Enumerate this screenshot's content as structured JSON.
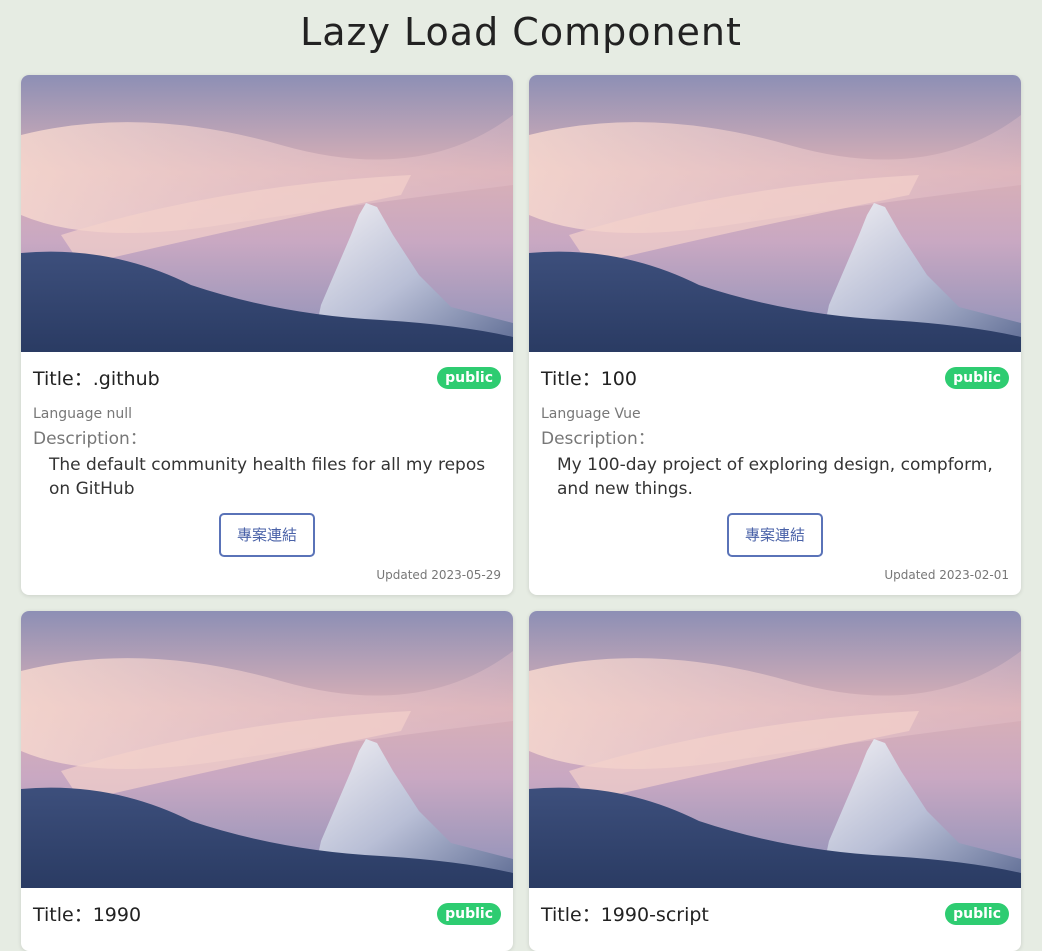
{
  "page": {
    "title": "Lazy Load Component"
  },
  "cards": [
    {
      "title": "Title：.github",
      "visibility": "public",
      "language": "Language null",
      "description_label": "Description：",
      "description": "The default community health files for all my repos on GitHub",
      "link_label": "專案連結",
      "updated": "Updated 2023-05-29"
    },
    {
      "title": "Title：100",
      "visibility": "public",
      "language": "Language Vue",
      "description_label": "Description：",
      "description": "My 100-day project of exploring design, compform, and new things.",
      "link_label": "專案連結",
      "updated": "Updated 2023-02-01"
    },
    {
      "title": "Title：1990",
      "visibility": "public"
    },
    {
      "title": "Title：1990-script",
      "visibility": "public"
    }
  ],
  "colors": {
    "background": "#e6ece3",
    "badge": "#2ecc71",
    "link_border": "#5a73b8"
  }
}
